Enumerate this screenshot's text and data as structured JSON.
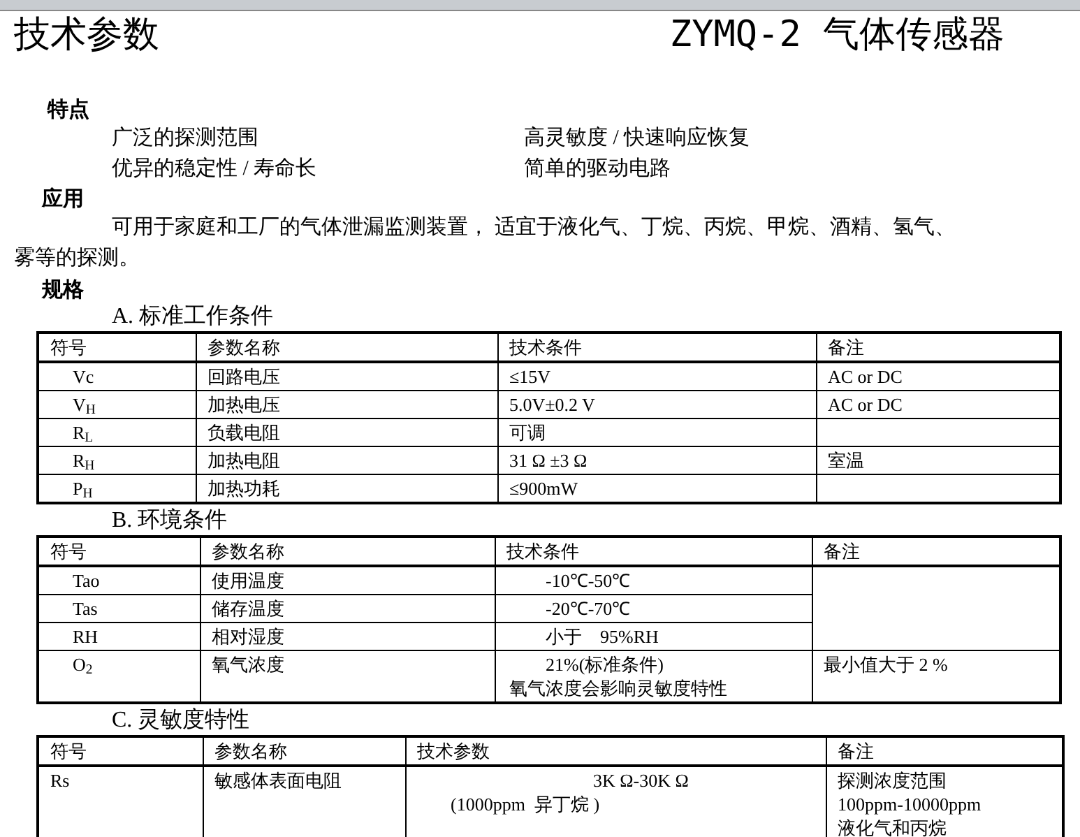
{
  "title": "技术参数",
  "product": "ZYMQ-2 气体传感器",
  "features": {
    "heading": "特点",
    "items": [
      "广泛的探测范围",
      "高灵敏度 / 快速响应恢复",
      "优异的稳定性 / 寿命长",
      "简单的驱动电路"
    ]
  },
  "application": {
    "heading": "应用",
    "lines": [
      "可用于家庭和工厂的气体泄漏监测装置， 适宜于液化气、丁烷、丙烷、甲烷、酒精、氢气、",
      "雾等的探测。"
    ]
  },
  "specs_heading": "规格",
  "tables": [
    {
      "title": "A.  标准工作条件",
      "columns": [
        "符号",
        "参数名称",
        "技术条件",
        "备注"
      ],
      "rows": [
        {
          "symbol": "Vc",
          "name": "回路电压",
          "condition": [
            "≤15V"
          ],
          "remark": "AC or DC"
        },
        {
          "symbol": "V$_{H}$",
          "name": "加热电压",
          "condition": [
            "5.0V±0.2 V"
          ],
          "remark": "AC or DC"
        },
        {
          "symbol": "R$_{L}$",
          "name": "负载电阻",
          "condition": [
            "可调"
          ]
        },
        {
          "symbol": "R$_{H}$",
          "name": "加热电阻",
          "condition": [
            "31 Ω ±3 Ω"
          ],
          "remark": "室温"
        },
        {
          "symbol": "P$_{H}$",
          "name": "加热功耗",
          "condition": [
            "≤900mW"
          ]
        }
      ]
    },
    {
      "title": "B.  环境条件",
      "columns": [
        "符号",
        "参数名称",
        "技术条件",
        "备注"
      ],
      "rows": [
        {
          "symbol": "Tao",
          "name": "使用温度",
          "condition": [
            "-10℃-50℃"
          ],
          "remark_merged": false
        },
        {
          "symbol": "Tas",
          "name": "储存温度",
          "condition": [
            "-20℃-70℃"
          ],
          "remark_merged": true
        },
        {
          "symbol": "RH",
          "name": "相对湿度",
          "condition": [
            "小于    95%RH"
          ],
          "remark_merged": true
        },
        {
          "symbol": "O$_{2}$",
          "name": "氧气浓度",
          "condition": [
            "21%(标准条件)",
            "氧气浓度会影响灵敏度特性"
          ],
          "remark": "最小值大于 2 %",
          "remark_merged": false
        }
      ]
    },
    {
      "title": "C.  灵敏度特性",
      "columns": [
        "符号",
        "参数名称",
        "技术参数",
        "备注"
      ],
      "rows": [
        {
          "symbol": "Rs",
          "name": "敏感体表面电阻",
          "condition": [
            "3K Ω-30K Ω",
            "(1000ppm  异丁烷 )"
          ],
          "remark_lines": [
            "探测浓度范围",
            "100ppm-10000ppm",
            "液化气和丙烷"
          ]
        }
      ]
    }
  ]
}
